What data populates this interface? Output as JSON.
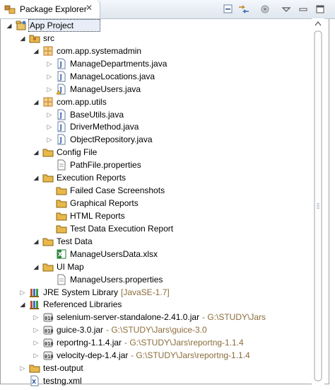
{
  "view": {
    "title": "Package Explorer",
    "close_glyph": "✕",
    "colors": {
      "folder": "#e8b84a",
      "package": "#c07a2a",
      "java": "#3a66b0",
      "jar": "#6b6b6b",
      "selection": "#e8eef7"
    }
  },
  "toolbar": {
    "collapse_all": "collapse-all-icon",
    "link_with_editor": "link-with-editor-icon",
    "focus": "focus-icon",
    "view_menu": "view-menu-icon",
    "minimize": "minimize-icon",
    "maximize": "maximize-icon"
  },
  "tree": [
    {
      "label": "App Project",
      "decoration": "",
      "icon": "project",
      "depth": 0,
      "state": "open",
      "selected": true
    },
    {
      "label": "src",
      "decoration": "",
      "icon": "src-folder",
      "depth": 1,
      "state": "open"
    },
    {
      "label": "com.app.systemadmin",
      "decoration": "",
      "icon": "package",
      "depth": 2,
      "state": "open"
    },
    {
      "label": "ManageDepartments.java",
      "decoration": "",
      "icon": "java",
      "depth": 3,
      "state": "closed"
    },
    {
      "label": "ManageLocations.java",
      "decoration": "",
      "icon": "java",
      "depth": 3,
      "state": "closed"
    },
    {
      "label": "ManageUsers.java",
      "decoration": "",
      "icon": "java-warn",
      "depth": 3,
      "state": "closed"
    },
    {
      "label": "com.app.utils",
      "decoration": "",
      "icon": "package",
      "depth": 2,
      "state": "open"
    },
    {
      "label": "BaseUtils.java",
      "decoration": "",
      "icon": "java",
      "depth": 3,
      "state": "closed"
    },
    {
      "label": "DriverMethod.java",
      "decoration": "",
      "icon": "java",
      "depth": 3,
      "state": "closed"
    },
    {
      "label": "ObjectRepository.java",
      "decoration": "",
      "icon": "java",
      "depth": 3,
      "state": "closed"
    },
    {
      "label": "Config File",
      "decoration": "",
      "icon": "folder",
      "depth": 2,
      "state": "open"
    },
    {
      "label": "PathFile.properties",
      "decoration": "",
      "icon": "file",
      "depth": 3,
      "state": "none"
    },
    {
      "label": "Execution Reports",
      "decoration": "",
      "icon": "folder",
      "depth": 2,
      "state": "open"
    },
    {
      "label": "Failed Case Screenshots",
      "decoration": "",
      "icon": "folder",
      "depth": 3,
      "state": "none"
    },
    {
      "label": "Graphical Reports",
      "decoration": "",
      "icon": "folder",
      "depth": 3,
      "state": "none"
    },
    {
      "label": "HTML Reports",
      "decoration": "",
      "icon": "folder",
      "depth": 3,
      "state": "none"
    },
    {
      "label": "Test Data Execution Report",
      "decoration": "",
      "icon": "folder",
      "depth": 3,
      "state": "none"
    },
    {
      "label": "Test Data",
      "decoration": "",
      "icon": "folder",
      "depth": 2,
      "state": "open"
    },
    {
      "label": "ManageUsersData.xlsx",
      "decoration": "",
      "icon": "excel",
      "depth": 3,
      "state": "none"
    },
    {
      "label": "UI Map",
      "decoration": "",
      "icon": "folder",
      "depth": 2,
      "state": "open"
    },
    {
      "label": "ManageUsers.properties",
      "decoration": "",
      "icon": "file",
      "depth": 3,
      "state": "none"
    },
    {
      "label": "JRE System Library",
      "decoration": "[JavaSE-1.7]",
      "icon": "library",
      "depth": 1,
      "state": "closed"
    },
    {
      "label": "Referenced Libraries",
      "decoration": "",
      "icon": "library",
      "depth": 1,
      "state": "open"
    },
    {
      "label": "selenium-server-standalone-2.41.0.jar",
      "decoration": "- G:\\STUDY\\Jars",
      "icon": "jar",
      "depth": 2,
      "state": "closed"
    },
    {
      "label": "guice-3.0.jar",
      "decoration": "- G:\\STUDY\\Jars\\guice-3.0",
      "icon": "jar",
      "depth": 2,
      "state": "closed"
    },
    {
      "label": "reportng-1.1.4.jar",
      "decoration": "- G:\\STUDY\\Jars\\reportng-1.1.4",
      "icon": "jar",
      "depth": 2,
      "state": "closed"
    },
    {
      "label": "velocity-dep-1.4.jar",
      "decoration": "- G:\\STUDY\\Jars\\reportng-1.1.4",
      "icon": "jar",
      "depth": 2,
      "state": "closed"
    },
    {
      "label": "test-output",
      "decoration": "",
      "icon": "folder",
      "depth": 1,
      "state": "closed"
    },
    {
      "label": "testng.xml",
      "decoration": "",
      "icon": "xml",
      "depth": 1,
      "state": "none"
    }
  ]
}
